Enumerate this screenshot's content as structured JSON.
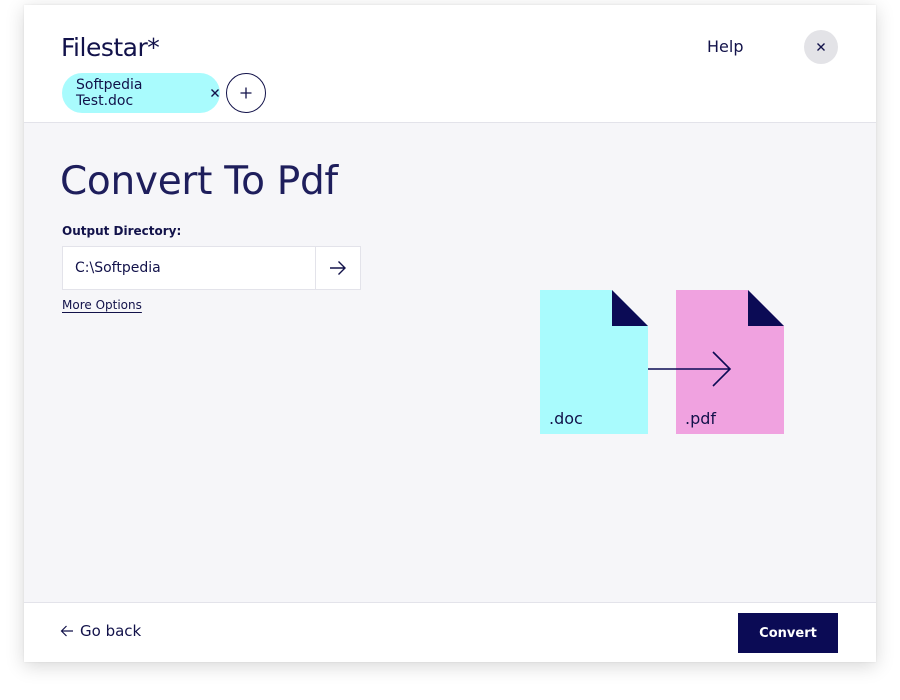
{
  "app": {
    "brand": "Filestar*",
    "help_label": "Help"
  },
  "files": [
    {
      "name": "Softpedia Test.doc"
    }
  ],
  "main": {
    "title": "Convert To Pdf",
    "output_label": "Output Directory:",
    "output_value": "C:\\Softpedia",
    "more_options_label": "More Options"
  },
  "illustration": {
    "source_ext": ".doc",
    "target_ext": ".pdf",
    "source_color": "#a9fbfd",
    "target_color": "#f0a2e0",
    "corner_color": "#0b0b55"
  },
  "footer": {
    "back_label": "Go back",
    "convert_label": "Convert"
  },
  "icons": {
    "close": "close-icon",
    "chip_remove": "close-icon",
    "add": "plus-icon",
    "go": "arrow-right-icon",
    "back": "arrow-left-icon"
  }
}
